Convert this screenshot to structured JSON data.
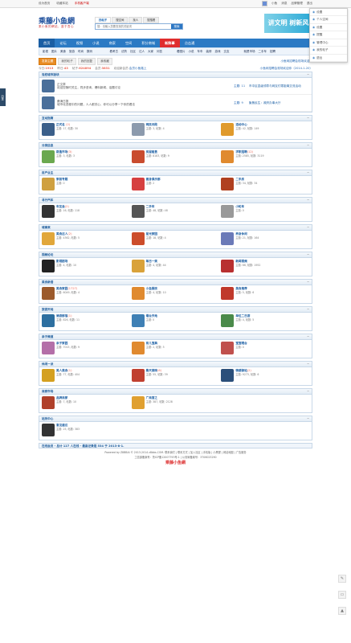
{
  "topbar": {
    "home": "设为首页",
    "fav": "收藏本站",
    "mobile": "手机客户端",
    "user": "小鱼",
    "tip": "消息",
    "mgmt": "品牌管理",
    "quit": "退出"
  },
  "logo": {
    "main": "乘藤小鱼網",
    "sub": "乘小鱼的網站，遂于吾心"
  },
  "search": {
    "tabs": [
      "找帖子",
      "搜空间",
      "找人",
      "搜搜看"
    ],
    "placeholder": "搜：请输入您要查找的关键词",
    "button": "搜索"
  },
  "ad": "讲文明 树新风",
  "user_menu": [
    "设置",
    "个人空间",
    "设置",
    "提醒",
    "管理中心",
    "我的帖子",
    "退出"
  ],
  "nav": [
    "首页",
    "论坛",
    "视频",
    "小说",
    "商家",
    "空间",
    "积分商城",
    "新鲜事",
    "点击通"
  ],
  "subnav": [
    [
      "影视",
      "图片",
      "美食",
      "旅游",
      "时尚",
      "数码"
    ],
    [
      "看考古",
      "试药",
      "社区",
      "达人",
      "大家",
      "问答"
    ],
    [
      "看图片",
      "小说",
      "车车",
      "装修",
      "游戏",
      "交友"
    ],
    [
      "就是市场",
      "二手车",
      "招聘"
    ]
  ],
  "postbar": {
    "btn_new": "发新主题",
    "btn_reply": "我的帖子",
    "btn_mine": "我的回复",
    "btn_plus": "我收藏",
    "right": "小鱼网招聘会现场欢迎你"
  },
  "stats": {
    "today_label": "今日:",
    "today": "1913",
    "yest_label": "昨日:",
    "yest": "43",
    "posts_label": "帖子:",
    "posts": "624894",
    "members_label": "会员:",
    "members": "3831",
    "newest_label": "欢迎新会员:",
    "newest": "会员小鱼路上",
    "right": "小鱼网招聘会现场欢迎你（2014-1-20）"
  },
  "sections": [
    {
      "title": "党校城市版块",
      "wide": true,
      "items": [
        {
          "name": "正文章",
          "desc": "欢迎您随时关注，同步咨询，爆料新闻、话题讨论",
          "topics": "主题: 11",
          "last": "市中区县级领导与网友们零距离交流活动"
        },
        {
          "name": "桑海日报",
          "desc": "城市化进程中的问题，人人都关心，你可以分享一下你的看法",
          "topics": "主题: 9",
          "last": "聚焦民生：政府办事大厅"
        }
      ]
    },
    {
      "title": "互动指南",
      "items": [
        {
          "name": "正式名 ",
          "n": "2",
          "meta": "主题: 17, 帖数: 30",
          "c": "#3b5f8a"
        },
        {
          "name": "网民问政",
          "n": "",
          "meta": "主题: 3, 帖数: 4",
          "c": "#8c9aad"
        },
        {
          "name": "活动中心",
          "n": "",
          "meta": "主题: 42, 帖数: 149",
          "c": "#e09a2c"
        }
      ]
    },
    {
      "title": "分类信息",
      "items": [
        {
          "name": "跳蚤市场",
          "n": "3",
          "meta": "主题: 3, 帖数: 3",
          "c": "#6aa84f"
        },
        {
          "name": "房屋租售",
          "n": "",
          "meta": "主题: 8183, 帖数: 9",
          "c": "#c94c2f"
        },
        {
          "name": "求职招聘",
          "n": "12",
          "meta": "主题: 2585, 帖数: 3119",
          "c": "#e08a2f"
        }
      ]
    },
    {
      "title": "房产业主",
      "items": [
        {
          "name": "家装专题",
          "n": "",
          "meta": "主题: 0",
          "c": "#cfa040"
        },
        {
          "name": "健身俱乐部",
          "n": "",
          "meta": "主题: 2",
          "c": "#d64040"
        },
        {
          "name": "二手房",
          "n": "",
          "meta": "主题: 34, 帖数: 34",
          "c": "#b04020"
        }
      ]
    },
    {
      "title": "寻行汽车",
      "items": [
        {
          "name": "车友会",
          "n": "2",
          "meta": "主题: 16, 帖数: 118",
          "c": "#333"
        },
        {
          "name": "二手车",
          "n": "",
          "meta": "主题: 48, 帖数: 48",
          "c": "#555"
        },
        {
          "name": "小轮车",
          "n": "",
          "meta": "主题: 0",
          "c": "#999"
        }
      ]
    },
    {
      "title": "城事来",
      "items": [
        {
          "name": "美食达人",
          "n": "2",
          "meta": "主题: 4362, 帖数: 5",
          "c": "#e1a73b"
        },
        {
          "name": "星光家园",
          "n": "",
          "meta": "主题: 18, 帖数: 4",
          "c": "#cc4d2b"
        },
        {
          "name": "养身休闲",
          "n": "",
          "meta": "主题: 21, 帖数: 164",
          "c": "#6b7ab8"
        }
      ]
    },
    {
      "title": "视频论坛",
      "items": [
        {
          "name": "影视剧场",
          "n": "",
          "meta": "主题: 4, 帖数: 10",
          "c": "#222"
        },
        {
          "name": "每日一笑",
          "n": "",
          "meta": "主题: 4, 帖数: 44",
          "c": "#d9a23a"
        },
        {
          "name": "新闻视频",
          "n": "",
          "meta": "主题: 66, 帖数: 1952",
          "c": "#b83030"
        }
      ]
    },
    {
      "title": "美食新语",
      "items": [
        {
          "name": "美食家园",
          "n": "1727",
          "meta": "主题: 6049, 帖数: 4",
          "c": "#9c5a2b"
        },
        {
          "name": "小鱼厨房",
          "n": "",
          "meta": "主题: 4, 帖数: 10",
          "c": "#e08a2f"
        },
        {
          "name": "美食推荐",
          "n": "",
          "meta": "主题: 5, 帖数: 6",
          "c": "#c0392b"
        }
      ]
    },
    {
      "title": "旅游天地",
      "items": [
        {
          "name": "骑游部落",
          "n": "1",
          "meta": "主题: 826, 帖数: 11",
          "c": "#2d6fa0"
        },
        {
          "name": "烟台天地",
          "n": "",
          "meta": "主题: 0",
          "c": "#3f80b5"
        },
        {
          "name": "单位二日游",
          "n": "",
          "meta": "主题: 4, 帖数: 5",
          "c": "#4a8a4a"
        }
      ]
    },
    {
      "title": "亲子频道",
      "items": [
        {
          "name": "亲子家园",
          "n": "",
          "meta": "主题: 7015, 帖数: 9",
          "c": "#b46fa8"
        },
        {
          "name": "育儿宝典",
          "n": "",
          "meta": "主题: 2, 帖数: 5",
          "c": "#e08a2f"
        },
        {
          "name": "宝宝晒台",
          "n": "",
          "meta": "主题: 0",
          "c": "#c0504d"
        }
      ]
    },
    {
      "title": "休闲一派",
      "items": [
        {
          "name": "美人美食",
          "n": "1",
          "meta": "主题: 77, 帖数: 404",
          "c": "#d4a020"
        },
        {
          "name": "桑天美味",
          "n": "6",
          "meta": "主题: 55, 帖数: 39",
          "c": "#c04030"
        },
        {
          "name": "情感驿站",
          "n": "2",
          "meta": "主题: 9273, 帖数: 6",
          "c": "#2b4f7a"
        }
      ]
    },
    {
      "title": "商家市场",
      "items": [
        {
          "name": "品牌商家",
          "n": "",
          "meta": "主题: 7, 帖数: 10",
          "c": "#b0402a"
        },
        {
          "name": "广商首之",
          "n": "",
          "meta": "主题: 387, 帖数: 2128",
          "c": "#e0a030"
        }
      ]
    },
    {
      "title": "站务中心",
      "items": [
        {
          "name": "意见建议",
          "n": "",
          "meta": "主题: 25, 帖数: 383",
          "c": "#333"
        }
      ]
    }
  ],
  "online": "在线会员 - 总计 127 人在线 - 最高记录是 534 于 2013-8-1.",
  "footer": {
    "line1": "Powered by Z8BBAI © 2013-2014 z8bbs.COM. 联系我们 | 联系方式 | 加入社区 | 手机版 | 小黑屋 | 网站地图 | 广告服务",
    "line2": "工信部备案号：鲁ICP备12007793号-1 | 公安局备案号：3706023290",
    "brand": "乘藤小鱼網"
  },
  "sidetab": "分享"
}
